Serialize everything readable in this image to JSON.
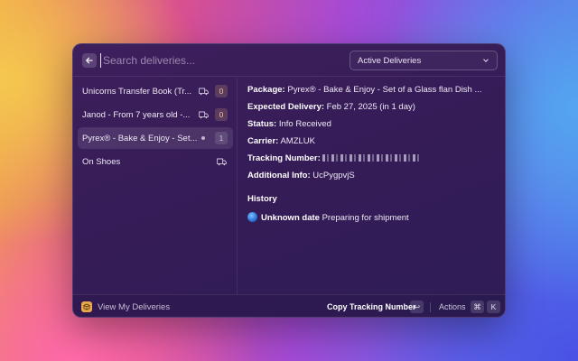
{
  "search": {
    "placeholder": "Search deliveries..."
  },
  "filter": {
    "selected": "Active Deliveries"
  },
  "deliveries": [
    {
      "title": "Unicorns Transfer Book (Tr...",
      "icon": "truck-icon",
      "count": "0"
    },
    {
      "title": "Janod - From 7 years old -...",
      "icon": "truck-icon",
      "count": "0"
    },
    {
      "title": "Pyrex® - Bake & Enjoy - Set...",
      "icon": "dot-icon",
      "count": "1"
    },
    {
      "title": "On Shoes",
      "icon": "truck-icon",
      "count": ""
    }
  ],
  "detail": {
    "package_label": "Package:",
    "package_value": "Pyrex® - Bake & Enjoy - Set of a Glass flan Dish ...",
    "expected_label": "Expected Delivery:",
    "expected_value": "Feb 27, 2025 (in 1 day)",
    "status_label": "Status:",
    "status_value": "Info Received",
    "carrier_label": "Carrier:",
    "carrier_value": "AMZLUK",
    "tracking_label": "Tracking Number:",
    "additional_label": "Additional Info:",
    "additional_value": "UcPygpvjS",
    "history_title": "History",
    "history": [
      {
        "date": "Unknown date",
        "text": "Preparing for shipment"
      }
    ]
  },
  "footer": {
    "title": "View My Deliveries",
    "primary_action": "Copy Tracking Number",
    "primary_key": "↩",
    "actions_label": "Actions",
    "actions_key_1": "⌘",
    "actions_key_2": "K"
  },
  "colors": {
    "window_bg": "#351c57",
    "count_accent": "#f0c58a",
    "app_icon": "#e8a94a",
    "history_dot": "#2a73d9"
  }
}
